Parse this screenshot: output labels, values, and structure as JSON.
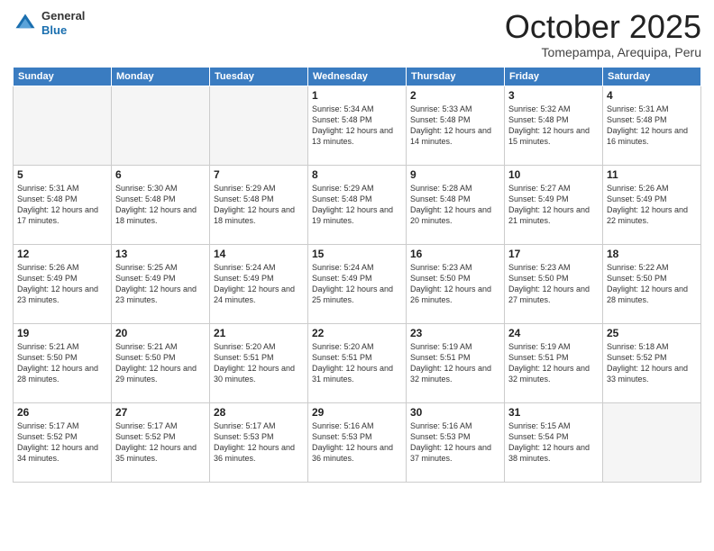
{
  "header": {
    "logo_general": "General",
    "logo_blue": "Blue",
    "month_title": "October 2025",
    "location": "Tomepampa, Arequipa, Peru"
  },
  "days_of_week": [
    "Sunday",
    "Monday",
    "Tuesday",
    "Wednesday",
    "Thursday",
    "Friday",
    "Saturday"
  ],
  "weeks": [
    [
      {
        "day": "",
        "info": "",
        "empty": true
      },
      {
        "day": "",
        "info": "",
        "empty": true
      },
      {
        "day": "",
        "info": "",
        "empty": true
      },
      {
        "day": "1",
        "info": "Sunrise: 5:34 AM\nSunset: 5:48 PM\nDaylight: 12 hours\nand 13 minutes.",
        "empty": false
      },
      {
        "day": "2",
        "info": "Sunrise: 5:33 AM\nSunset: 5:48 PM\nDaylight: 12 hours\nand 14 minutes.",
        "empty": false
      },
      {
        "day": "3",
        "info": "Sunrise: 5:32 AM\nSunset: 5:48 PM\nDaylight: 12 hours\nand 15 minutes.",
        "empty": false
      },
      {
        "day": "4",
        "info": "Sunrise: 5:31 AM\nSunset: 5:48 PM\nDaylight: 12 hours\nand 16 minutes.",
        "empty": false
      }
    ],
    [
      {
        "day": "5",
        "info": "Sunrise: 5:31 AM\nSunset: 5:48 PM\nDaylight: 12 hours\nand 17 minutes.",
        "empty": false
      },
      {
        "day": "6",
        "info": "Sunrise: 5:30 AM\nSunset: 5:48 PM\nDaylight: 12 hours\nand 18 minutes.",
        "empty": false
      },
      {
        "day": "7",
        "info": "Sunrise: 5:29 AM\nSunset: 5:48 PM\nDaylight: 12 hours\nand 18 minutes.",
        "empty": false
      },
      {
        "day": "8",
        "info": "Sunrise: 5:29 AM\nSunset: 5:48 PM\nDaylight: 12 hours\nand 19 minutes.",
        "empty": false
      },
      {
        "day": "9",
        "info": "Sunrise: 5:28 AM\nSunset: 5:48 PM\nDaylight: 12 hours\nand 20 minutes.",
        "empty": false
      },
      {
        "day": "10",
        "info": "Sunrise: 5:27 AM\nSunset: 5:49 PM\nDaylight: 12 hours\nand 21 minutes.",
        "empty": false
      },
      {
        "day": "11",
        "info": "Sunrise: 5:26 AM\nSunset: 5:49 PM\nDaylight: 12 hours\nand 22 minutes.",
        "empty": false
      }
    ],
    [
      {
        "day": "12",
        "info": "Sunrise: 5:26 AM\nSunset: 5:49 PM\nDaylight: 12 hours\nand 23 minutes.",
        "empty": false
      },
      {
        "day": "13",
        "info": "Sunrise: 5:25 AM\nSunset: 5:49 PM\nDaylight: 12 hours\nand 23 minutes.",
        "empty": false
      },
      {
        "day": "14",
        "info": "Sunrise: 5:24 AM\nSunset: 5:49 PM\nDaylight: 12 hours\nand 24 minutes.",
        "empty": false
      },
      {
        "day": "15",
        "info": "Sunrise: 5:24 AM\nSunset: 5:49 PM\nDaylight: 12 hours\nand 25 minutes.",
        "empty": false
      },
      {
        "day": "16",
        "info": "Sunrise: 5:23 AM\nSunset: 5:50 PM\nDaylight: 12 hours\nand 26 minutes.",
        "empty": false
      },
      {
        "day": "17",
        "info": "Sunrise: 5:23 AM\nSunset: 5:50 PM\nDaylight: 12 hours\nand 27 minutes.",
        "empty": false
      },
      {
        "day": "18",
        "info": "Sunrise: 5:22 AM\nSunset: 5:50 PM\nDaylight: 12 hours\nand 28 minutes.",
        "empty": false
      }
    ],
    [
      {
        "day": "19",
        "info": "Sunrise: 5:21 AM\nSunset: 5:50 PM\nDaylight: 12 hours\nand 28 minutes.",
        "empty": false
      },
      {
        "day": "20",
        "info": "Sunrise: 5:21 AM\nSunset: 5:50 PM\nDaylight: 12 hours\nand 29 minutes.",
        "empty": false
      },
      {
        "day": "21",
        "info": "Sunrise: 5:20 AM\nSunset: 5:51 PM\nDaylight: 12 hours\nand 30 minutes.",
        "empty": false
      },
      {
        "day": "22",
        "info": "Sunrise: 5:20 AM\nSunset: 5:51 PM\nDaylight: 12 hours\nand 31 minutes.",
        "empty": false
      },
      {
        "day": "23",
        "info": "Sunrise: 5:19 AM\nSunset: 5:51 PM\nDaylight: 12 hours\nand 32 minutes.",
        "empty": false
      },
      {
        "day": "24",
        "info": "Sunrise: 5:19 AM\nSunset: 5:51 PM\nDaylight: 12 hours\nand 32 minutes.",
        "empty": false
      },
      {
        "day": "25",
        "info": "Sunrise: 5:18 AM\nSunset: 5:52 PM\nDaylight: 12 hours\nand 33 minutes.",
        "empty": false
      }
    ],
    [
      {
        "day": "26",
        "info": "Sunrise: 5:17 AM\nSunset: 5:52 PM\nDaylight: 12 hours\nand 34 minutes.",
        "empty": false
      },
      {
        "day": "27",
        "info": "Sunrise: 5:17 AM\nSunset: 5:52 PM\nDaylight: 12 hours\nand 35 minutes.",
        "empty": false
      },
      {
        "day": "28",
        "info": "Sunrise: 5:17 AM\nSunset: 5:53 PM\nDaylight: 12 hours\nand 36 minutes.",
        "empty": false
      },
      {
        "day": "29",
        "info": "Sunrise: 5:16 AM\nSunset: 5:53 PM\nDaylight: 12 hours\nand 36 minutes.",
        "empty": false
      },
      {
        "day": "30",
        "info": "Sunrise: 5:16 AM\nSunset: 5:53 PM\nDaylight: 12 hours\nand 37 minutes.",
        "empty": false
      },
      {
        "day": "31",
        "info": "Sunrise: 5:15 AM\nSunset: 5:54 PM\nDaylight: 12 hours\nand 38 minutes.",
        "empty": false
      },
      {
        "day": "",
        "info": "",
        "empty": true
      }
    ]
  ]
}
